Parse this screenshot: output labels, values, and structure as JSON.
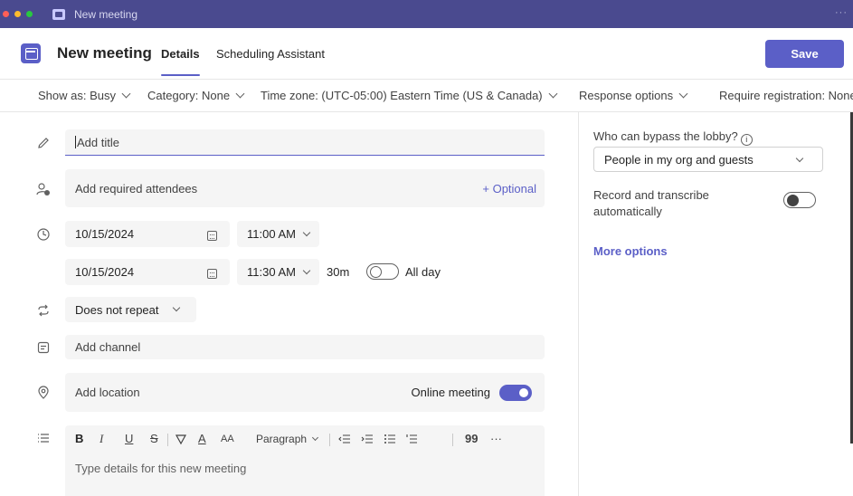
{
  "window": {
    "title": "New meeting",
    "more": "···"
  },
  "header": {
    "title": "New meeting",
    "tabs": [
      {
        "label": "Details",
        "active": true
      },
      {
        "label": "Scheduling Assistant",
        "active": false
      }
    ],
    "save_label": "Save"
  },
  "options": {
    "show_as": "Show as: Busy",
    "category": "Category: None",
    "time_zone": "Time zone: (UTC-05:00) Eastern Time (US & Canada)",
    "response_options": "Response options",
    "require_registration": "Require registration: None"
  },
  "form": {
    "title_placeholder": "Add title",
    "attendees_placeholder": "Add required attendees",
    "optional_link": "+ Optional",
    "start_date": "10/15/2024",
    "start_time": "11:00 AM",
    "end_date": "10/15/2024",
    "end_time": "11:30 AM",
    "duration": "30m",
    "all_day_label": "All day",
    "all_day": false,
    "repeat": "Does not repeat",
    "channel_placeholder": "Add channel",
    "location_placeholder": "Add location",
    "online_meeting_label": "Online meeting",
    "online_meeting": true,
    "editor": {
      "paragraph_label": "Paragraph",
      "placeholder": "Type details for this new meeting",
      "toolbar": [
        "B",
        "I",
        "U",
        "S",
        "A",
        "AA",
        "99",
        "···"
      ]
    }
  },
  "sidebar": {
    "lobby_label": "Who can bypass the lobby?",
    "lobby_value": "People in my org and guests",
    "record_label": "Record and transcribe automatically",
    "record": false,
    "more_options": "More options"
  },
  "colors": {
    "accent": "#5b5fc7",
    "titlebar": "#4a4a8f"
  }
}
